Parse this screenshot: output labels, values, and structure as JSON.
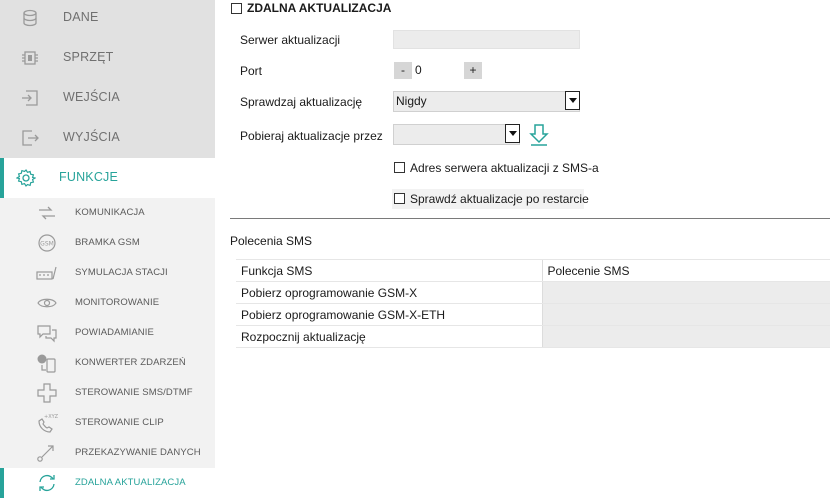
{
  "sidebar": {
    "main": [
      {
        "label": "DANE",
        "icon": "database-icon"
      },
      {
        "label": "SPRZĘT",
        "icon": "chip-icon"
      },
      {
        "label": "WEJŚCIA",
        "icon": "input-icon"
      },
      {
        "label": "WYJŚCIA",
        "icon": "output-icon"
      },
      {
        "label": "FUNKCJE",
        "icon": "gear-icon",
        "active": true
      }
    ],
    "sub": [
      {
        "label": "KOMUNIKACJA",
        "icon": "communication-icon"
      },
      {
        "label": "BRAMKA GSM",
        "icon": "gsm-gateway-icon"
      },
      {
        "label": "SYMULACJA STACJI",
        "icon": "station-simulation-icon"
      },
      {
        "label": "MONITOROWANIE",
        "icon": "eye-icon"
      },
      {
        "label": "POWIADAMIANIE",
        "icon": "notification-icon"
      },
      {
        "label": "KONWERTER ZDARZEŃ",
        "icon": "event-converter-icon"
      },
      {
        "label": "STEROWANIE SMS/DTMF",
        "icon": "sms-control-icon"
      },
      {
        "label": "STEROWANIE CLIP",
        "icon": "clip-control-icon"
      },
      {
        "label": "PRZEKAZYWANIE DANYCH",
        "icon": "data-forward-icon"
      },
      {
        "label": "ZDALNA AKTUALIZACJA",
        "icon": "refresh-icon",
        "active": true
      }
    ]
  },
  "section": {
    "title": "ZDALNA AKTUALIZACJA",
    "server_label": "Serwer aktualizacji",
    "server_value": "",
    "port_label": "Port",
    "port_minus": "-",
    "port_value": "0",
    "port_plus": "+",
    "check_label": "Sprawdzaj aktualizację",
    "check_value": "Nigdy",
    "download_label": "Pobieraj aktualizacje przez",
    "download_value": "",
    "sms_address_label": "Adres serwera aktualizacji z SMS-a",
    "restart_check_label": "Sprawdź aktualizacje po restarcie"
  },
  "sms": {
    "heading": "Polecenia SMS",
    "col_function": "Funkcja SMS",
    "col_command": "Polecenie SMS",
    "rows": [
      {
        "function": "Pobierz oprogramowanie GSM-X",
        "command": ""
      },
      {
        "function": "Pobierz oprogramowanie GSM-X-ETH",
        "command": ""
      },
      {
        "function": "Rozpocznij aktualizację",
        "command": ""
      }
    ]
  },
  "colors": {
    "accent": "#27a39a",
    "sidebar_bg": "#e1e1e1",
    "sub_bg": "#f2f2f2"
  }
}
